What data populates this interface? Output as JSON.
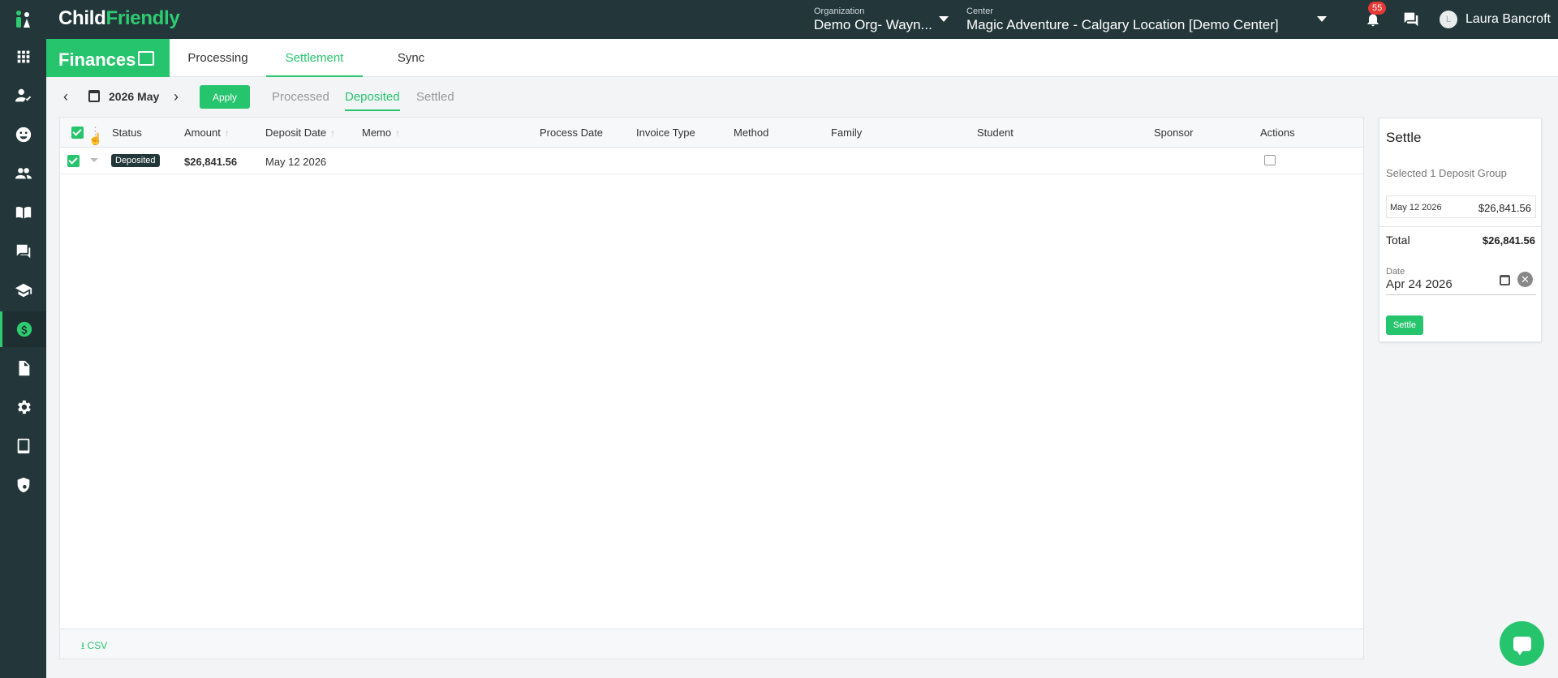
{
  "app": {
    "logo_part1": "Child",
    "logo_part2": "Friendly"
  },
  "header": {
    "org_label": "Organization",
    "org_value": "Demo Org- Wayn...",
    "center_label": "Center",
    "center_value": "Magic Adventure - Calgary Location [Demo Center]",
    "notification_count": "55",
    "user_initial": "L",
    "user_name": "Laura Bancroft"
  },
  "sidebar": {
    "items": [
      {
        "icon": "apps-grid-icon"
      },
      {
        "icon": "user-check-icon"
      },
      {
        "icon": "child-face-icon"
      },
      {
        "icon": "people-icon"
      },
      {
        "icon": "book-icon"
      },
      {
        "icon": "messages-icon"
      },
      {
        "icon": "graduation-cap-icon"
      },
      {
        "icon": "dollar-icon",
        "active": true
      },
      {
        "icon": "document-icon"
      },
      {
        "icon": "gear-icon"
      },
      {
        "icon": "tablet-icon"
      },
      {
        "icon": "shield-gear-icon"
      }
    ]
  },
  "tabs": {
    "section": "Finances",
    "items": [
      "Processing",
      "Settlement",
      "Sync"
    ],
    "active": "Settlement"
  },
  "filter": {
    "month": "2026 May",
    "apply_label": "Apply",
    "subtabs": [
      "Processed",
      "Deposited",
      "Settled"
    ],
    "active_subtab": "Deposited"
  },
  "table": {
    "columns": [
      "Status",
      "Amount",
      "Deposit Date",
      "Memo",
      "Process Date",
      "Invoice Type",
      "Method",
      "Family",
      "Student",
      "Sponsor",
      "Actions"
    ],
    "rows": [
      {
        "status": "Deposited",
        "amount": "$26,841.56",
        "deposit_date": "May 12 2026",
        "memo": "",
        "process_date": "",
        "invoice_type": "",
        "method": "",
        "family": "",
        "student": "",
        "sponsor": ""
      }
    ],
    "csv_label": "CSV"
  },
  "settle": {
    "title": "Settle",
    "selected_text": "Selected 1 Deposit Group",
    "item_date": "May 12 2026",
    "item_amount": "$26,841.56",
    "total_label": "Total",
    "total_amount": "$26,841.56",
    "date_label": "Date",
    "date_value": "Apr 24 2026",
    "button_label": "Settle"
  },
  "colors": {
    "brand_green": "#27c46e",
    "header_dark": "#23373a",
    "badge_red": "#e53935"
  }
}
